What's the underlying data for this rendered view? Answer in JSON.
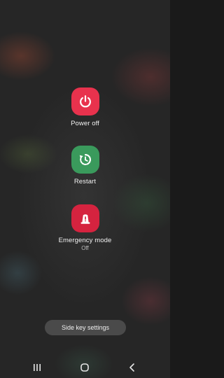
{
  "power_menu": {
    "power_off": {
      "label": "Power off",
      "icon": "power-icon",
      "color": "#e8324d"
    },
    "restart": {
      "label": "Restart",
      "icon": "restart-icon",
      "color": "#3a9a5c"
    },
    "emergency": {
      "label": "Emergency mode",
      "status": "Off",
      "icon": "emergency-light-icon",
      "color": "#d5233f"
    },
    "side_key_settings": {
      "label": "Side key settings"
    }
  },
  "navigation_bar": {
    "recents": {
      "icon": "recents-icon"
    },
    "home": {
      "icon": "home-icon"
    },
    "back": {
      "icon": "back-icon"
    }
  }
}
